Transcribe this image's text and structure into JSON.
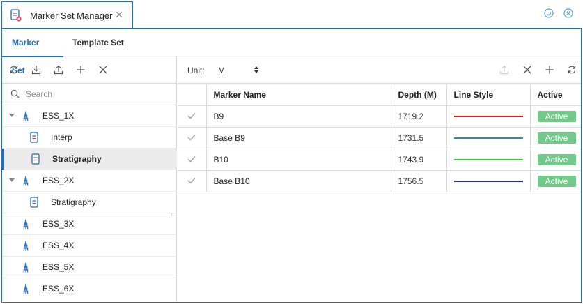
{
  "window": {
    "title": "Marker Set Manager"
  },
  "tabs": [
    {
      "label": "Marker Set",
      "active": true
    },
    {
      "label": "Template Set",
      "active": false
    }
  ],
  "left": {
    "search_placeholder": "Search",
    "tree": [
      {
        "label": "ESS_1X",
        "type": "well",
        "expanded": true
      },
      {
        "label": "Interp",
        "type": "document",
        "child": true
      },
      {
        "label": "Stratigraphy",
        "type": "document",
        "child": true,
        "selected": true
      },
      {
        "label": "ESS_2X",
        "type": "well",
        "expanded": true
      },
      {
        "label": "Stratigraphy",
        "type": "document",
        "child": true
      },
      {
        "label": "ESS_3X",
        "type": "well"
      },
      {
        "label": "ESS_4X",
        "type": "well"
      },
      {
        "label": "ESS_5X",
        "type": "well"
      },
      {
        "label": "ESS_6X",
        "type": "well"
      }
    ]
  },
  "right": {
    "unit_label": "Unit:",
    "unit_value": "M",
    "columns": [
      "",
      "Marker Name",
      "Depth (M)",
      "Line Style",
      "Active"
    ],
    "rows": [
      {
        "name": "B9",
        "depth": "1719.2",
        "line_color": "#e02020",
        "status": "Active"
      },
      {
        "name": "Base B9",
        "depth": "1731.5",
        "line_color": "#3a7fc4",
        "status": "Active"
      },
      {
        "name": "B10",
        "depth": "1743.9",
        "line_color": "#2ec52e",
        "status": "Active"
      },
      {
        "name": "Base B10",
        "depth": "1756.5",
        "line_color": "#2b2ba0",
        "status": "Active"
      }
    ]
  },
  "colors": {
    "accent": "#1f6fbf",
    "badge_green": "#72c98a",
    "border_blue": "#2b6cb0"
  }
}
